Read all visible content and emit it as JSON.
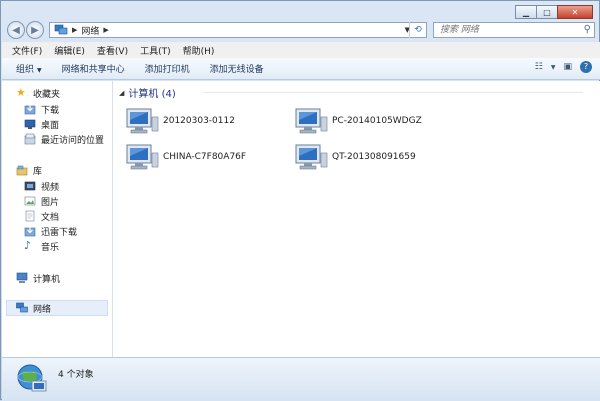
{
  "address": {
    "crumb": "网络"
  },
  "search": {
    "placeholder": "搜索 网络"
  },
  "menu": [
    "文件(F)",
    "编辑(E)",
    "查看(V)",
    "工具(T)",
    "帮助(H)"
  ],
  "toolbar": {
    "organize": "组织",
    "network_center": "网络和共享中心",
    "add_printer": "添加打印机",
    "add_wireless": "添加无线设备"
  },
  "nav": {
    "favorites": "收藏夹",
    "favorites_items": [
      "下载",
      "桌面",
      "最近访问的位置"
    ],
    "library": "库",
    "library_items": [
      "视频",
      "图片",
      "文档",
      "迅雷下载",
      "音乐"
    ],
    "computer": "计算机",
    "network": "网络"
  },
  "group": {
    "title": "计算机 (4)"
  },
  "computers": [
    "20120303-0112",
    "PC-20140105WDGZ",
    "CHINA-C7F80A76F",
    "QT-201308091659"
  ],
  "status": {
    "count": "4 个对象"
  },
  "colors": {
    "accent": "#1e3287",
    "selection": "#e5eef9"
  }
}
